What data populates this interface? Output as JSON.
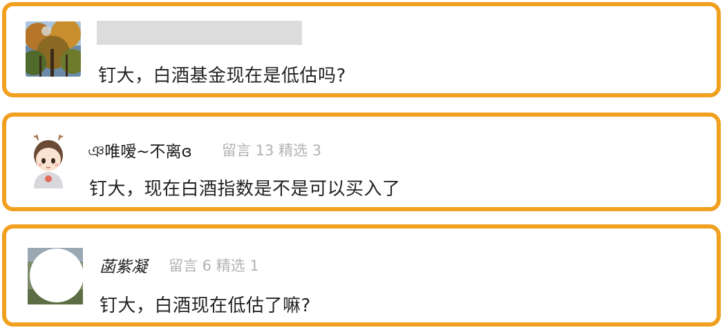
{
  "comments": [
    {
      "avatar": "autumn-tree-photo-avatar",
      "name": "",
      "name_redacted": true,
      "text": "钉大，白酒基金现在是低估吗?"
    },
    {
      "avatar": "cartoon-boy-avatar",
      "name": "ঞ唯嗳~不离ɞ",
      "stats": "留言 13 精选 3",
      "text": "钉大，现在白酒指数是不是可以买入了"
    },
    {
      "avatar": "white-circle-photo-avatar",
      "name": "菡紫凝",
      "stats": "留言 6 精选 1",
      "text": "钉大，白酒现在低估了嘛?"
    }
  ],
  "colors": {
    "highlight_border": "#F0A01E",
    "meta_text": "#b2b2b2",
    "body_text": "#222222",
    "redaction": "#dcdcdc"
  }
}
